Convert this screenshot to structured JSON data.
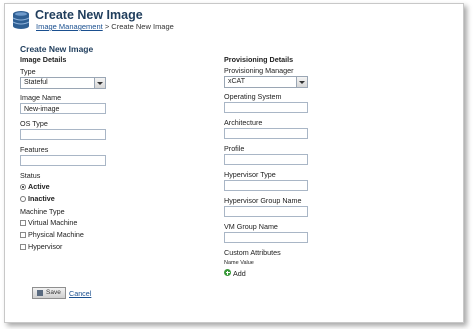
{
  "header": {
    "title": "Create New Image",
    "breadcrumb_link": "Image Management",
    "breadcrumb_sep": ">",
    "breadcrumb_current": "Create New Image"
  },
  "form": {
    "title": "Create New Image",
    "image_details": {
      "heading": "Image Details",
      "type_label": "Type",
      "type_value": "Stateful",
      "image_name_label": "Image Name",
      "image_name_value": "New-image",
      "os_type_label": "OS Type",
      "os_type_value": "",
      "features_label": "Features",
      "features_value": "",
      "status_label": "Status",
      "status_active": "Active",
      "status_inactive": "Inactive",
      "machine_type_label": "Machine Type",
      "machine_virtual": "Virtual Machine",
      "machine_physical": "Physical Machine",
      "machine_hypervisor": "Hypervisor"
    },
    "provisioning_details": {
      "heading": "Provisioning Details",
      "manager_label": "Provisioning Manager",
      "manager_value": "xCAT",
      "os_label": "Operating System",
      "arch_label": "Architecture",
      "profile_label": "Profile",
      "hv_type_label": "Hypervisor Type",
      "hv_group_label": "Hypervisor Group Name",
      "vm_group_label": "VM Group Name",
      "custom_attr_label": "Custom Attributes",
      "name_value_header": "Name Value",
      "add_label": "Add"
    },
    "actions": {
      "save_label": "Save",
      "cancel_label": "Cancel"
    }
  }
}
